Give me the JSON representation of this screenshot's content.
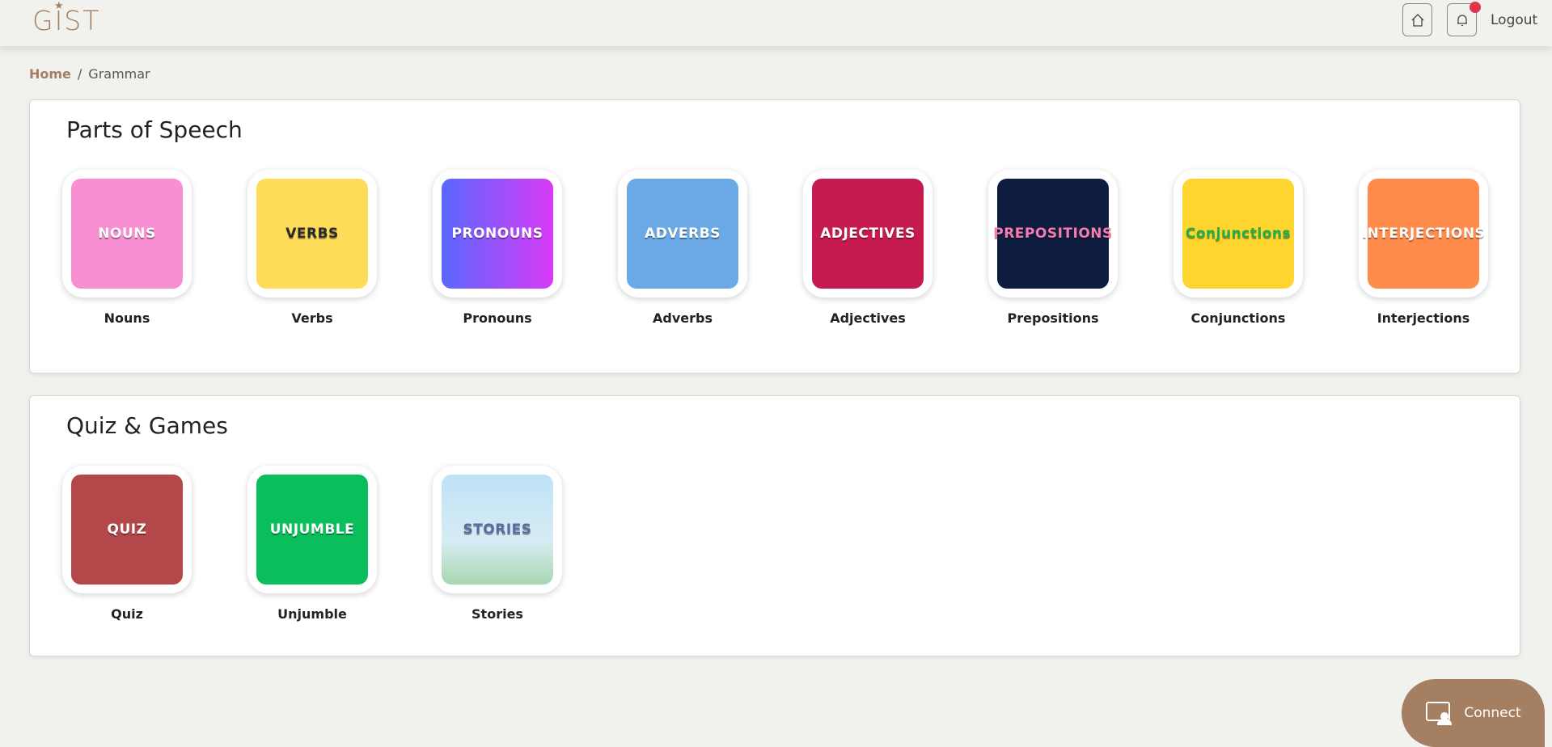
{
  "header": {
    "logo": "GIST",
    "logout": "Logout",
    "icons": [
      "home-icon",
      "bell-icon"
    ],
    "notification_dot_color": "#e0344a"
  },
  "breadcrumb": {
    "home": "Home",
    "separator": "/",
    "current": "Grammar"
  },
  "sections": [
    {
      "title": "Parts of Speech",
      "items": [
        {
          "label": "Nouns",
          "art": "NOUNS",
          "color": "#f78fd2",
          "text_color": "#ffffff"
        },
        {
          "label": "Verbs",
          "art": "VERBS",
          "color": "#fedc5a",
          "text_color": "#2a2a2a"
        },
        {
          "label": "Pronouns",
          "art": "PRONOUNS",
          "color": "linear-gradient(90deg,#5a68ff,#d83af5)",
          "text_color": "#ffffff"
        },
        {
          "label": "Adverbs",
          "art": "ADVERBS",
          "color": "#6aa9e6",
          "text_color": "#ffffff"
        },
        {
          "label": "Adjectives",
          "art": "ADJECTIVES",
          "color": "#c51b4e",
          "text_color": "#ffffff"
        },
        {
          "label": "Prepositions",
          "art": "PREPOSITIONS",
          "color": "#0e1c3f",
          "text_color": "#f57bb0"
        },
        {
          "label": "Conjunctions",
          "art": "Conjunctions",
          "color": "#fdd52e",
          "text_color": "#1fae4a"
        },
        {
          "label": "Interjections",
          "art": "INTERJECTIONS",
          "color": "#ff8c4b",
          "text_color": "#ffffff"
        }
      ]
    },
    {
      "title": "Quiz & Games",
      "items": [
        {
          "label": "Quiz",
          "art": "QUIZ",
          "color": "#b3474a",
          "text_color": "#ffffff"
        },
        {
          "label": "Unjumble",
          "art": "UNJUMBLE",
          "color": "#0abf5b",
          "text_color": "#ffffff"
        },
        {
          "label": "Stories",
          "art": "STORIES",
          "color": "linear-gradient(180deg,#bfe2f6,#d6ecf4 60%,#a9d7b0)",
          "text_color": "#5a6aa0"
        }
      ]
    }
  ],
  "connect": {
    "label": "Connect",
    "icon": "screen-user-icon",
    "color": "#a57f62"
  }
}
